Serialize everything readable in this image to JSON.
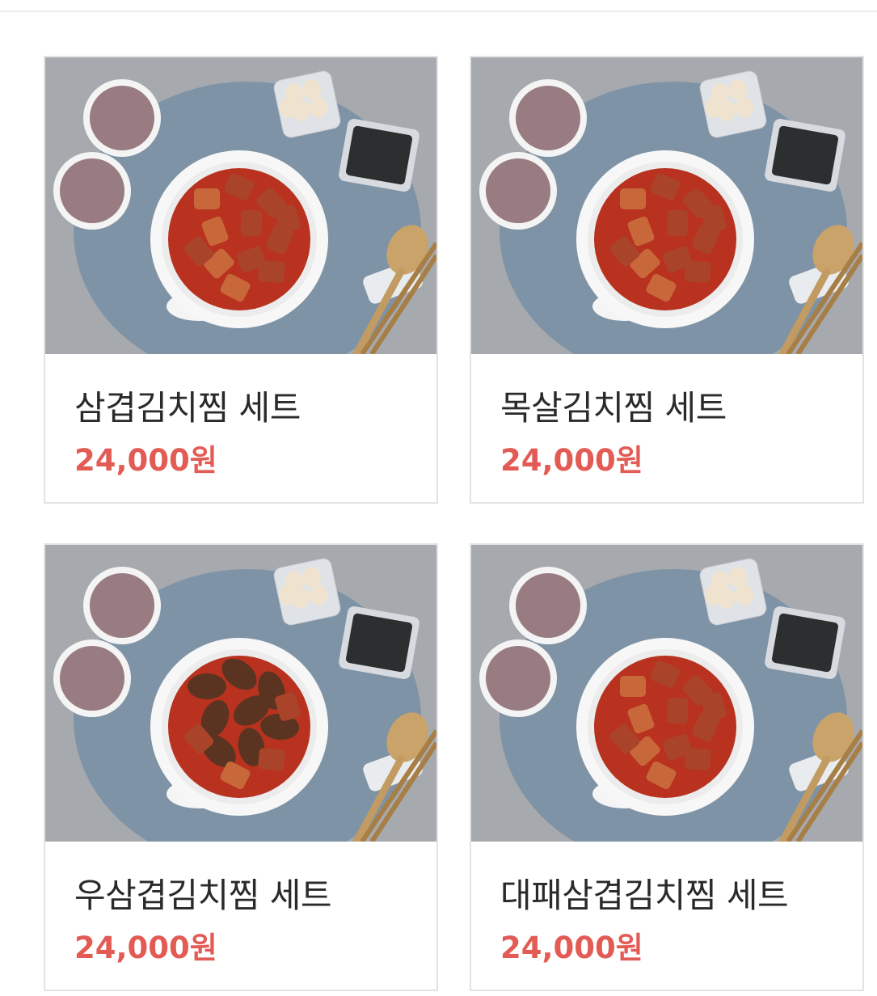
{
  "products": [
    {
      "name": "삼겹김치찜 세트",
      "price": "24,000원",
      "image": "pork-kimchi-jjim-set-photo",
      "topping": "pork-belly"
    },
    {
      "name": "목살김치찜 세트",
      "price": "24,000원",
      "image": "pork-neck-kimchi-jjim-set-photo",
      "topping": "pork-neck"
    },
    {
      "name": "우삼겹김치찜 세트",
      "price": "24,000원",
      "image": "beef-brisket-kimchi-jjim-set-photo",
      "topping": "beef-brisket"
    },
    {
      "name": "대패삼겹김치찜 세트",
      "price": "24,000원",
      "image": "thin-pork-belly-kimchi-jjim-set-photo",
      "topping": "thin-pork-belly"
    }
  ],
  "colors": {
    "price": "#e35b55",
    "title": "#2a2a2a",
    "card_border": "#e3e3e3",
    "photo_background": "#9fa2a6",
    "placemat": "#7f93a6"
  }
}
